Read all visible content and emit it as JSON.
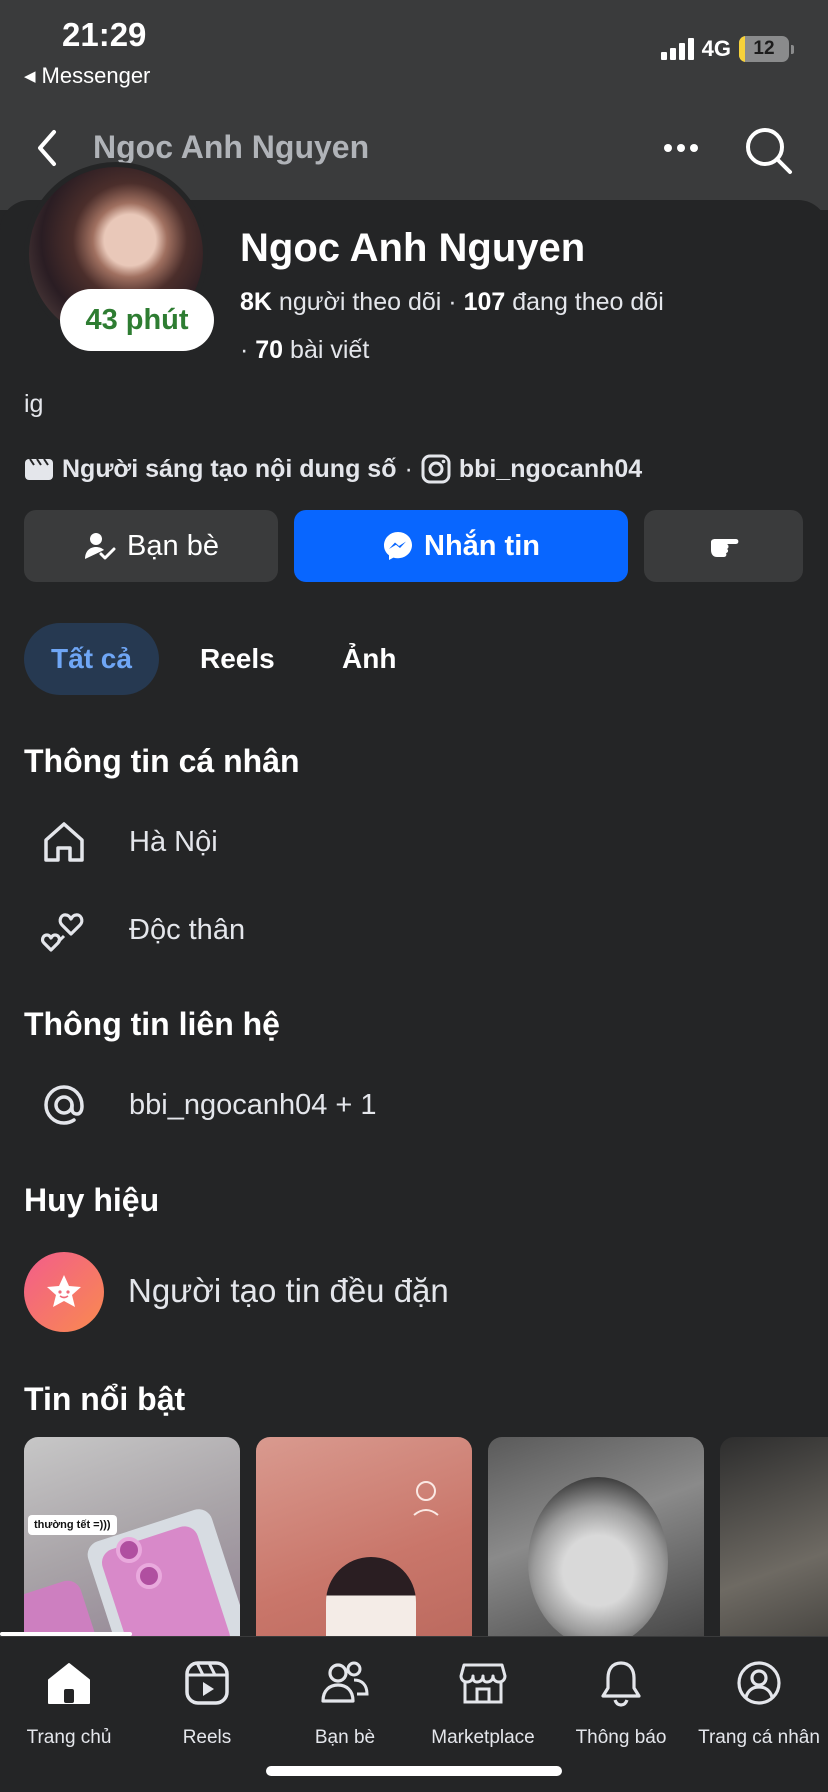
{
  "status_bar": {
    "time": "21:29",
    "back_app": "Messenger",
    "network": "4G",
    "battery": "12",
    "battery_level": 0.12
  },
  "header": {
    "title": "Ngoc Anh Nguyen"
  },
  "profile": {
    "name": "Ngoc Anh Nguyen",
    "active_badge": "43 phút",
    "followers_count": "8K",
    "followers_label": "người theo dõi",
    "following_count": "107",
    "following_label": "đang theo dõi",
    "posts_count": "70",
    "posts_label": "bài viết",
    "bio": "ig",
    "category": "Người sáng tạo nội dung số",
    "instagram": "bbi_ngocanh04"
  },
  "actions": {
    "friends": "Bạn bè",
    "message": "Nhắn tin"
  },
  "filters": [
    "Tất cả",
    "Reels",
    "Ảnh"
  ],
  "sections": {
    "personal_info": {
      "title": "Thông tin cá nhân",
      "items": [
        "Hà Nội",
        "Độc thân"
      ]
    },
    "contact_info": {
      "title": "Thông tin liên hệ",
      "items": [
        "bbi_ngocanh04 + 1"
      ]
    },
    "badges": {
      "title": "Huy hiệu",
      "items": [
        "Người tạo tin đều đặn"
      ]
    },
    "featured": {
      "title": "Tin nổi bật",
      "story_sticker": "thường tết =)))"
    }
  },
  "tabbar": [
    "Trang chủ",
    "Reels",
    "Bạn bè",
    "Marketplace",
    "Thông báo",
    "Trang cá nhân"
  ]
}
